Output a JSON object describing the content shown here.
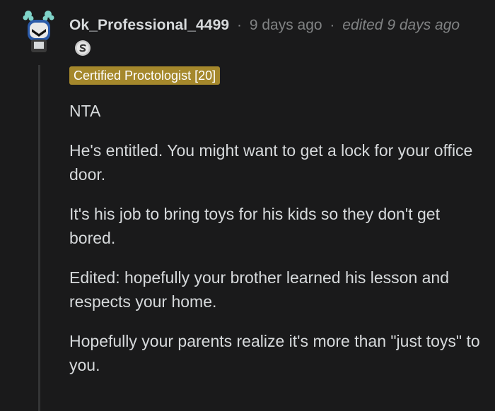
{
  "comment": {
    "username": "Ok_Professional_4499",
    "separator": "·",
    "timestamp": "9 days ago",
    "edited": "edited 9 days ago",
    "award_icon": "silver-award-icon",
    "flair": "Certified Proctologist [20]",
    "paragraphs": [
      "NTA",
      "He's entitled. You might want to get a lock for your office door.",
      "It's his job to bring toys for his kids so they don't get bored.",
      "Edited: hopefully your brother learned his lesson and respects your home.",
      "Hopefully your parents realize it's more than \"just toys\" to you."
    ]
  },
  "colors": {
    "background": "#1a1a1b",
    "text": "#d7dadc",
    "meta": "#818384",
    "flair_bg": "#a5882c",
    "thread_line": "#343536"
  }
}
